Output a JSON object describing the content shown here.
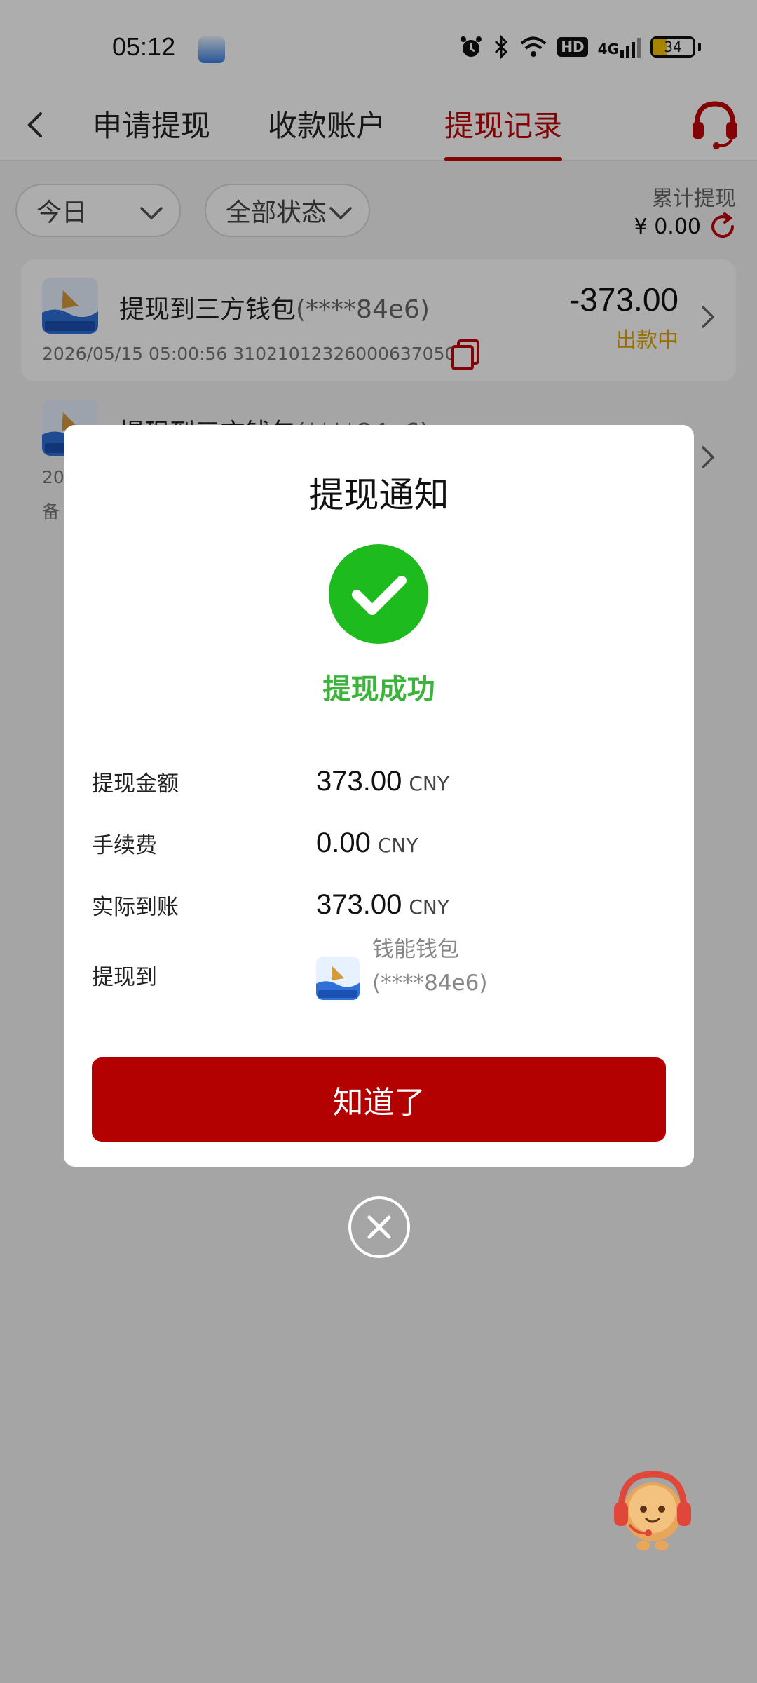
{
  "status_bar": {
    "time": "05:12",
    "battery": "34",
    "network": "4G",
    "hd": "HD",
    "icons": [
      "alarm-icon",
      "bluetooth-icon",
      "wifi-icon",
      "signal-icon",
      "battery-icon"
    ]
  },
  "header": {
    "tabs": [
      {
        "label": "申请提现",
        "active": false
      },
      {
        "label": "收款账户",
        "active": false
      },
      {
        "label": "提现记录",
        "active": true
      }
    ]
  },
  "filters": {
    "date": "今日",
    "status": "全部状态"
  },
  "summary": {
    "label": "累计提现",
    "value": "¥ 0.00"
  },
  "records": [
    {
      "title": "提现到三方钱包",
      "account": "(****84e6)",
      "datetime": "2026/05/15 05:00:56",
      "order_no": "310210123260006370500",
      "amount": "-373.00",
      "status": "出款中"
    },
    {
      "title": "提现到三方钱包",
      "account": "(****84e6)",
      "datetime_partial": "20",
      "remark_partial": "备"
    }
  ],
  "dialog": {
    "title": "提现通知",
    "status": "提现成功",
    "amount_label": "提现金额",
    "amount_value": "373.00",
    "amount_currency": "CNY",
    "fee_label": "手续费",
    "fee_value": "0.00",
    "fee_currency": "CNY",
    "actual_label": "实际到账",
    "actual_value": "373.00",
    "actual_currency": "CNY",
    "to_label": "提现到",
    "to_wallet": "钱能钱包",
    "to_account": "(****84e6)",
    "confirm_label": "知道了"
  },
  "colors": {
    "brand_red": "#b30000",
    "tab_active": "#c0060a",
    "success_green": "#1dbb1d",
    "pending_yellow": "#e0a400"
  }
}
